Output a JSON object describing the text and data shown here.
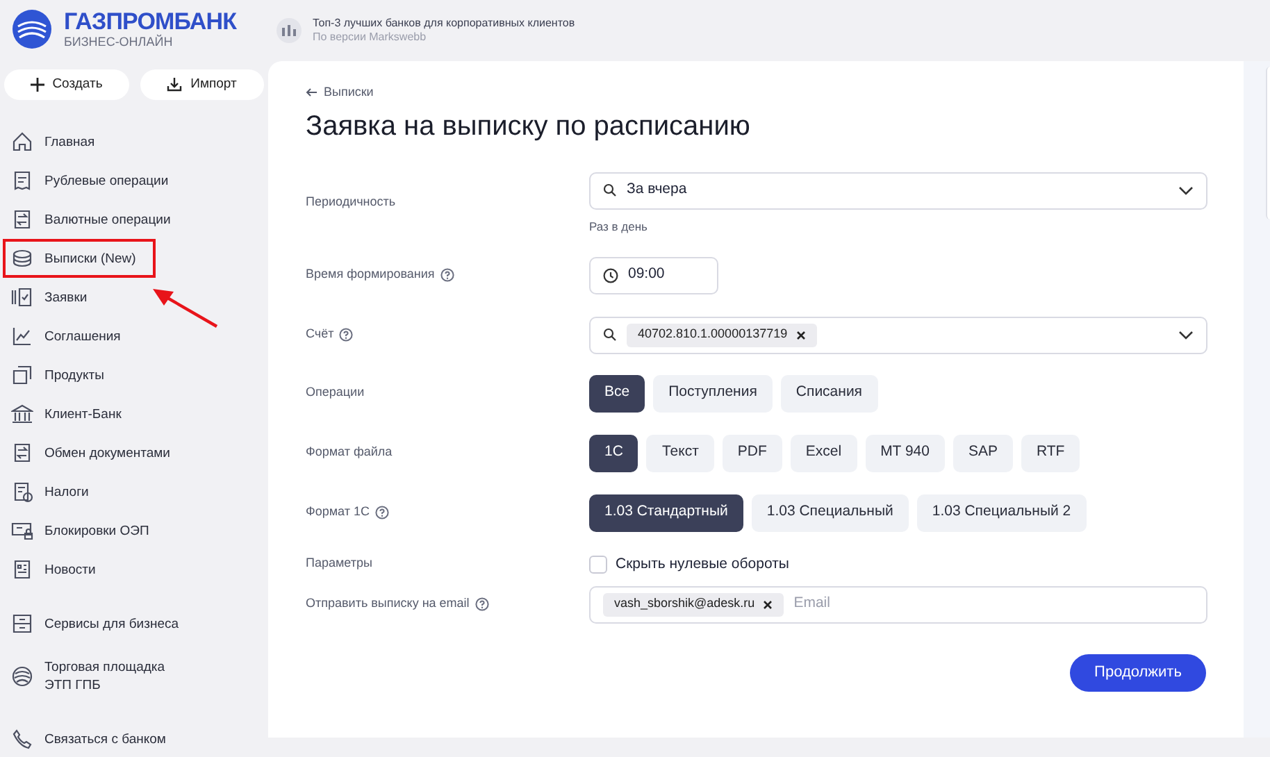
{
  "logo": {
    "name": "ГАЗПРОМБАНК",
    "subtitle": "БИЗНЕС-ОНЛАЙН"
  },
  "award": {
    "title": "Топ-3 лучших банков для корпоративных клиентов",
    "subtitle": "По версии Markswebb"
  },
  "actions": [
    "Создать",
    "Импорт"
  ],
  "sidebar": {
    "items": [
      {
        "label": "Главная",
        "selected": false
      },
      {
        "label": "Рублевые операции",
        "selected": false
      },
      {
        "label": "Валютные операции",
        "selected": false
      },
      {
        "label": "Выписки (New)",
        "selected": true
      },
      {
        "label": "Заявки",
        "selected": false
      },
      {
        "label": "Соглашения",
        "selected": false
      },
      {
        "label": "Продукты",
        "selected": false
      },
      {
        "label": "Клиент-Банк",
        "selected": false
      },
      {
        "label": "Обмен документами",
        "selected": false
      },
      {
        "label": "Налоги",
        "selected": false
      },
      {
        "label": "Блокировки ОЭП",
        "selected": false
      },
      {
        "label": "Новости",
        "selected": false
      }
    ],
    "extra_items": [
      "Сервисы для бизнеса",
      "Торговая площадка ЭТП ГПБ"
    ],
    "contact": "Связаться с банком"
  },
  "breadcrumb": "Выписки",
  "title": "Заявка на выписку по расписанию",
  "form": [
    {
      "kind": "select",
      "label": "Периодичность",
      "value": "За вчера",
      "hint": "Раз в день"
    },
    {
      "kind": "time",
      "label": "Время формирования",
      "help": true,
      "value": "09:00"
    },
    {
      "kind": "chips",
      "label": "Счёт",
      "help": true,
      "chips": [
        "40702.810.1.00000137719"
      ]
    },
    {
      "kind": "segments",
      "label": "Операции",
      "options": [
        {
          "label": "Все",
          "selected": true
        },
        {
          "label": "Поступления",
          "selected": false
        },
        {
          "label": "Списания",
          "selected": false
        }
      ]
    },
    {
      "kind": "segments",
      "label": "Формат файла",
      "options": [
        {
          "label": "1С",
          "selected": true
        },
        {
          "label": "Текст",
          "selected": false
        },
        {
          "label": "PDF",
          "selected": false
        },
        {
          "label": "Excel",
          "selected": false
        },
        {
          "label": "MT 940",
          "selected": false
        },
        {
          "label": "SAP",
          "selected": false
        },
        {
          "label": "RTF",
          "selected": false
        }
      ]
    },
    {
      "kind": "segments",
      "label": "Формат 1С",
      "help": true,
      "options": [
        {
          "label": "1.03 Стандартный",
          "selected": true
        },
        {
          "label": "1.03 Специальный",
          "selected": false
        },
        {
          "label": "1.03 Специальный 2",
          "selected": false
        }
      ]
    },
    {
      "kind": "checkbox",
      "label": "Параметры",
      "text": "Скрыть нулевые обороты",
      "checked": false
    },
    {
      "kind": "email",
      "label": "Отправить выписку на email",
      "help": true,
      "chips": [
        "vash_sborshik@adesk.ru"
      ],
      "placeholder": "Email"
    }
  ],
  "submit": "Продолжить"
}
